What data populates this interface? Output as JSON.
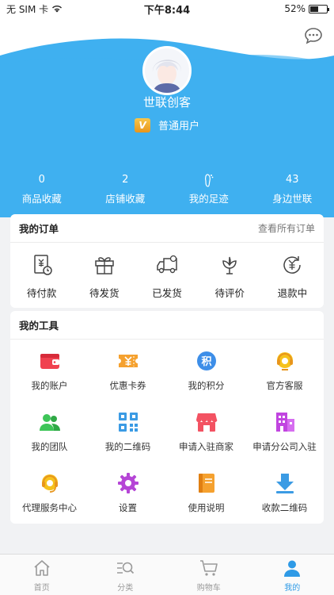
{
  "status_bar": {
    "carrier": "无 SIM 卡",
    "time": "下午8:44",
    "battery": "52%",
    "battery_level": 0.52
  },
  "profile": {
    "username": "世联创客",
    "vip_badge": "V",
    "level": "普通用户"
  },
  "stats": [
    {
      "value": "0",
      "label": "商品收藏"
    },
    {
      "value": "2",
      "label": "店铺收藏"
    },
    {
      "value": "",
      "label": "我的足迹",
      "icon": "footprint-icon"
    },
    {
      "value": "43",
      "label": "身边世联"
    }
  ],
  "orders": {
    "title": "我的订单",
    "view_all": "查看所有订单",
    "items": [
      {
        "label": "待付款",
        "icon": "payment-icon"
      },
      {
        "label": "待发货",
        "icon": "gift-icon"
      },
      {
        "label": "已发货",
        "icon": "truck-icon"
      },
      {
        "label": "待评价",
        "icon": "flower-icon"
      },
      {
        "label": "退款中",
        "icon": "refund-icon"
      }
    ]
  },
  "tools": {
    "title": "我的工具",
    "items": [
      {
        "label": "我的账户",
        "icon": "wallet-icon",
        "color": "#f0414f"
      },
      {
        "label": "优惠卡券",
        "icon": "coupon-icon",
        "color": "#f5a12f"
      },
      {
        "label": "我的积分",
        "icon": "points-icon",
        "color": "#3d8ee8"
      },
      {
        "label": "官方客服",
        "icon": "headset-icon",
        "color": "#f6c21c"
      },
      {
        "label": "我的团队",
        "icon": "team-icon",
        "color": "#3ec558"
      },
      {
        "label": "我的二维码",
        "icon": "qrcode-icon",
        "color": "#3b9be4"
      },
      {
        "label": "申请入驻商家",
        "icon": "store-icon",
        "color": "#f35262"
      },
      {
        "label": "申请分公司入驻",
        "icon": "building-icon",
        "color": "#c145e0"
      },
      {
        "label": "代理服务中心",
        "icon": "support-icon",
        "color": "#f6c21c"
      },
      {
        "label": "设置",
        "icon": "gear-icon",
        "color": "#b545d6"
      },
      {
        "label": "使用说明",
        "icon": "manual-icon",
        "color": "#f5a12f"
      },
      {
        "label": "收款二维码",
        "icon": "download-icon",
        "color": "#3b9be4"
      }
    ]
  },
  "tabbar": [
    {
      "label": "首页",
      "icon": "home-icon",
      "active": false
    },
    {
      "label": "分类",
      "icon": "category-icon",
      "active": false
    },
    {
      "label": "购物车",
      "icon": "cart-icon",
      "active": false
    },
    {
      "label": "我的",
      "icon": "user-icon",
      "active": true
    }
  ],
  "colors": {
    "header_blue": "#3fb0f0",
    "accent_blue": "#2e9ae6"
  }
}
